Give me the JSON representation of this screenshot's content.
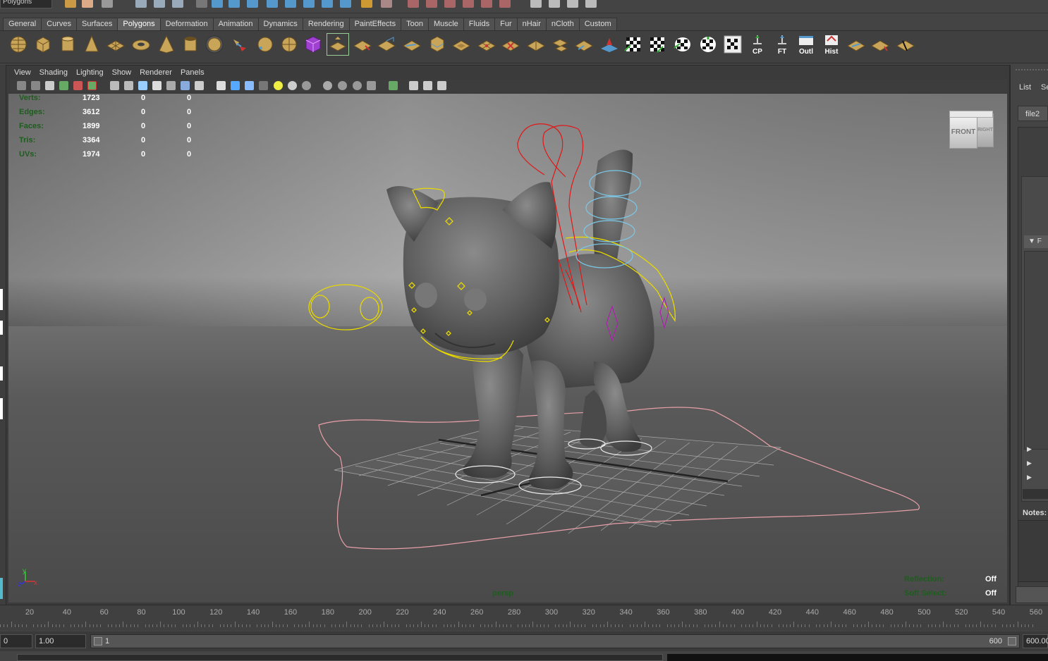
{
  "top_toolbar": {
    "mode_selector": "Polygons"
  },
  "shelf": {
    "tabs": [
      "General",
      "Curves",
      "Surfaces",
      "Polygons",
      "Deformation",
      "Animation",
      "Dynamics",
      "Rendering",
      "PaintEffects",
      "Toon",
      "Muscle",
      "Fluids",
      "Fur",
      "nHair",
      "nCloth",
      "Custom"
    ],
    "active_tab": "Polygons",
    "text_buttons": [
      "CP",
      "FT",
      "Outl",
      "Hist"
    ]
  },
  "panel_menu": [
    "View",
    "Shading",
    "Lighting",
    "Show",
    "Renderer",
    "Panels"
  ],
  "hud": {
    "rows": [
      {
        "label": "Verts:",
        "values": [
          "1723",
          "0",
          "0"
        ]
      },
      {
        "label": "Edges:",
        "values": [
          "3612",
          "0",
          "0"
        ]
      },
      {
        "label": "Faces:",
        "values": [
          "1899",
          "0",
          "0"
        ]
      },
      {
        "label": "Tris:",
        "values": [
          "3364",
          "0",
          "0"
        ]
      },
      {
        "label": "UVs:",
        "values": [
          "1974",
          "0",
          "0"
        ]
      }
    ],
    "camera": "persp",
    "reflection_label": "Reflection:",
    "reflection_value": "Off",
    "soft_select_label": "Soft Select:",
    "soft_select_value": "Off"
  },
  "view_cube": {
    "front": "FRONT",
    "right": "RIGHT"
  },
  "axis": {
    "x": "x",
    "y": "y",
    "z": "z"
  },
  "right_panel": {
    "tabs": [
      "List",
      "Se"
    ],
    "field": "file2",
    "section": "F",
    "notes_label": "Notes:"
  },
  "timeline": {
    "ticks": [
      "20",
      "40",
      "60",
      "80",
      "100",
      "120",
      "140",
      "160",
      "180",
      "200",
      "220",
      "240",
      "260",
      "280",
      "300",
      "320",
      "340",
      "360",
      "380",
      "400",
      "420",
      "440",
      "460",
      "480",
      "500",
      "520",
      "540",
      "560"
    ]
  },
  "range": {
    "start_time": "0",
    "playback_start": "1.00",
    "range_start": "1",
    "range_end": "600",
    "end_time": "600.00"
  },
  "colors": {
    "hud_label": "#1d5d1d",
    "ctrl_yellow": "#e8d800",
    "ctrl_red": "#e01818",
    "ctrl_cyan": "#7ac8e8",
    "ctrl_magenta": "#b020b0",
    "ctrl_pink": "#e8a0a8"
  }
}
